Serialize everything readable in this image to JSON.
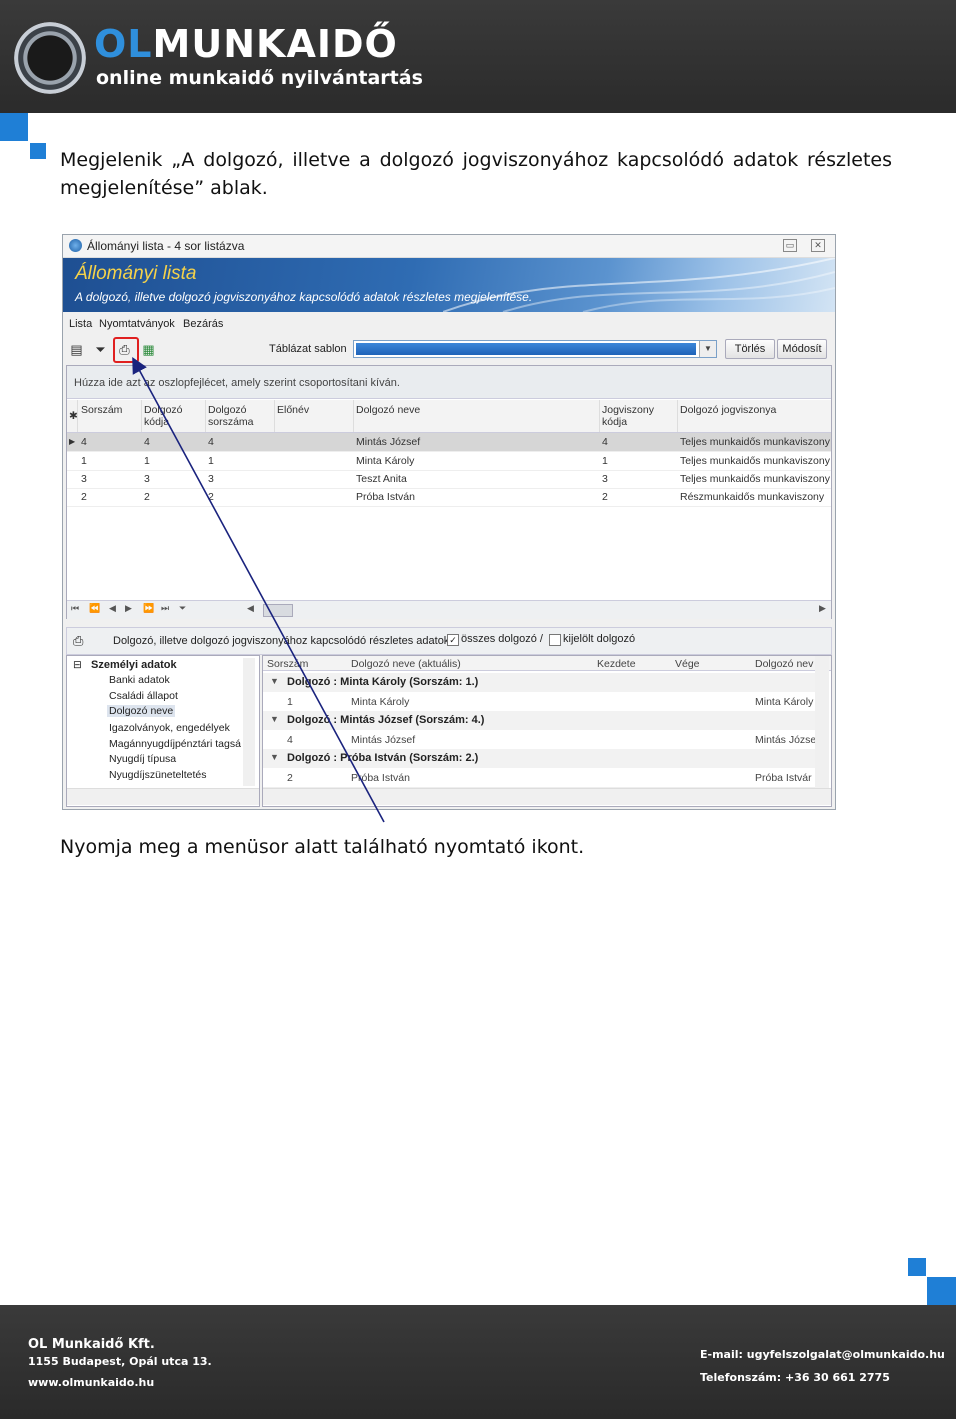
{
  "header": {
    "logo_prefix": "OL",
    "logo_main": "MUNKAIDŐ",
    "logo_subtitle": "online munkaidő nyilvántartás"
  },
  "intro_text": "Megjelenik „A dolgozó, illetve a dolgozó jogviszonyához kapcsolódó adatok részletes megjelenítése” ablak.",
  "window": {
    "title": "Állományi lista - 4 sor listázva",
    "banner_title": "Állományi lista",
    "banner_subtitle": "A dolgozó, illetve dolgozó jogviszonyához kapcsolódó adatok részletes megjelenítése.",
    "menu": [
      "Lista",
      "Nyomtatványok",
      "Bezárás"
    ],
    "toolbar": {
      "template_label": "Táblázat sablon",
      "delete_label": "Törlés",
      "modify_label": "Módosít"
    },
    "group_hint": "Húzza ide azt az oszlopfejlécet, amely szerint csoportosítani kíván.",
    "columns": [
      "Sorszám",
      "Dolgozó kódja",
      "Dolgozó sorszáma",
      "Előnév",
      "Dolgozó neve",
      "Jogviszony kódja",
      "Dolgozó jogviszonya"
    ],
    "rows": [
      {
        "sorszam": "4",
        "kod": "4",
        "dsorszam": "4",
        "elonev": "",
        "nev": "Mintás József",
        "jkod": "4",
        "jogviszony": "Teljes munkaidős munkaviszony"
      },
      {
        "sorszam": "1",
        "kod": "1",
        "dsorszam": "1",
        "elonev": "",
        "nev": "Minta Károly",
        "jkod": "1",
        "jogviszony": "Teljes munkaidős munkaviszony"
      },
      {
        "sorszam": "3",
        "kod": "3",
        "dsorszam": "3",
        "elonev": "",
        "nev": "Teszt Anita",
        "jkod": "3",
        "jogviszony": "Teljes munkaidős munkaviszony"
      },
      {
        "sorszam": "2",
        "kod": "2",
        "dsorszam": "2",
        "elonev": "",
        "nev": "Próba István",
        "jkod": "2",
        "jogviszony": "Részmunkaidős munkaviszony"
      }
    ],
    "detail": {
      "title": "Dolgozó, illetve dolgozó jogviszonyához kapcsolódó részletes adatok",
      "all_employees_label": "összes dolgozó /",
      "selected_employee_label": "kijelölt dolgozó",
      "tree_root": "Személyi adatok",
      "tree_items": [
        "Banki adatok",
        "Családi állapot",
        "Dolgozó neve",
        "Igazolványok, engedélyek",
        "Magánnyugdíjpénztári tagsá",
        "Nyugdíj típusa",
        "Nyugdíjszüneteltetés"
      ],
      "grid_columns": [
        "Sorszám",
        "Dolgozó neve (aktuális)",
        "Kezdete",
        "Vége",
        "Dolgozó nev"
      ],
      "groups": [
        {
          "label": "Dolgozó : Minta Károly (Sorszám: 1.)",
          "sorszam": "1",
          "nev": "Minta Károly",
          "nev2": "Minta Károly"
        },
        {
          "label": "Dolgozó : Mintás József (Sorszám: 4.)",
          "sorszam": "4",
          "nev": "Mintás József",
          "nev2": "Mintás Józse"
        },
        {
          "label": "Dolgozó : Próba István (Sorszám: 2.)",
          "sorszam": "2",
          "nev": "Próba István",
          "nev2": "Próba Istvár"
        }
      ]
    }
  },
  "instruction_text": "Nyomja meg a menüsor alatt található nyomtató ikont.",
  "footer": {
    "company": "OL Munkaidő Kft.",
    "address": "1155 Budapest, Opál utca 13.",
    "website": "www.olmunkaido.hu",
    "email": "E-mail: ugyfelszolgalat@olmunkaido.hu",
    "phone": "Telefonszám: +36 30 661 2775"
  },
  "colors": {
    "accent_blue": "#1f7fd6",
    "header_bg": "#333333",
    "highlight_red": "#e02020",
    "arrow_navy": "#1a237e"
  }
}
